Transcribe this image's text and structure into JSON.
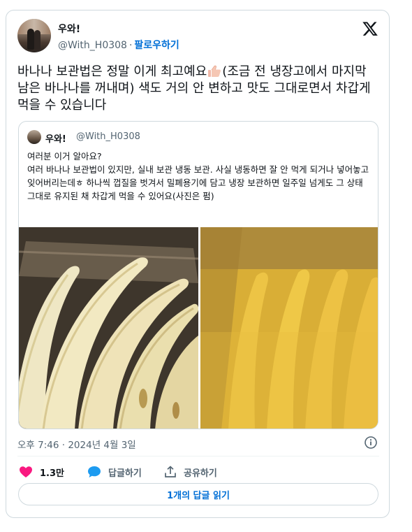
{
  "author": {
    "name": "우와!",
    "handle": "@With_H0308",
    "separator": "·",
    "follow_label": "팔로우하기"
  },
  "tweet": {
    "text_before_emoji": "바나나 보관법은 정말 이게 최고예요",
    "emoji": "thumbs-up-emoji",
    "text_after_emoji": "(조금 전 냉장고에서 마지막 남은 바나나를 꺼내며) 색도 거의 안 변하고 맛도 그대로면서 차갑게 먹을 수 있습니다"
  },
  "quoted": {
    "name": "우와!",
    "handle": "@With_H0308",
    "text": "여러분 이거 알아요?\n여러 바나나 보관법이 있지만, 실내 보관 냉동 보관. 사실 냉동하면 잘 안 먹게 되거나 넣어놓고 잊어버리는데ㅎ 하나씩 껍질을 벗겨서 밀폐용기에 담고 냉장 보관하면 일주일 넘게도 그 상태 그대로 유지된 채 차갑게 먹을 수 있어요(사진은 펌)"
  },
  "meta": {
    "time": "오후 7:46",
    "separator": "·",
    "date": "2024년 4월 3일"
  },
  "actions": {
    "like_count": "1.3만",
    "reply_label": "답글하기",
    "share_label": "공유하기"
  },
  "read_replies_label": "1개의 답글 읽기",
  "colors": {
    "accent": "#006fd6",
    "like": "#f91880",
    "reply_icon": "#1d9bf0",
    "border": "#cfd9de",
    "secondary_text": "#536471"
  }
}
